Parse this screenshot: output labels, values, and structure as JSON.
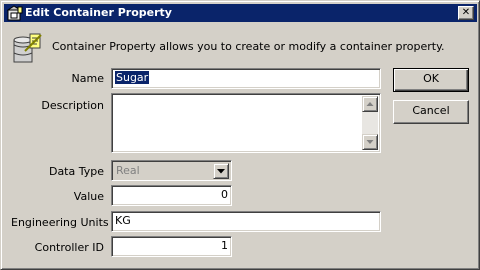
{
  "window": {
    "title": "Edit Container Property",
    "close_glyph": "✕"
  },
  "info": {
    "text": "Container Property allows you to create or modify a container property."
  },
  "form": {
    "name": {
      "label": "Name",
      "value": "Sugar"
    },
    "description": {
      "label": "Description",
      "value": ""
    },
    "data_type": {
      "label": "Data Type",
      "value": "Real"
    },
    "value": {
      "label": "Value",
      "value": "0"
    },
    "engineering_units": {
      "label": "Engineering Units",
      "value": "KG"
    },
    "controller_id": {
      "label": "Controller ID",
      "value": "1"
    }
  },
  "buttons": {
    "ok": "OK",
    "cancel": "Cancel"
  },
  "colors": {
    "titlebar": "#0a246a",
    "face": "#d4d0c8",
    "selection": "#0a246a"
  }
}
